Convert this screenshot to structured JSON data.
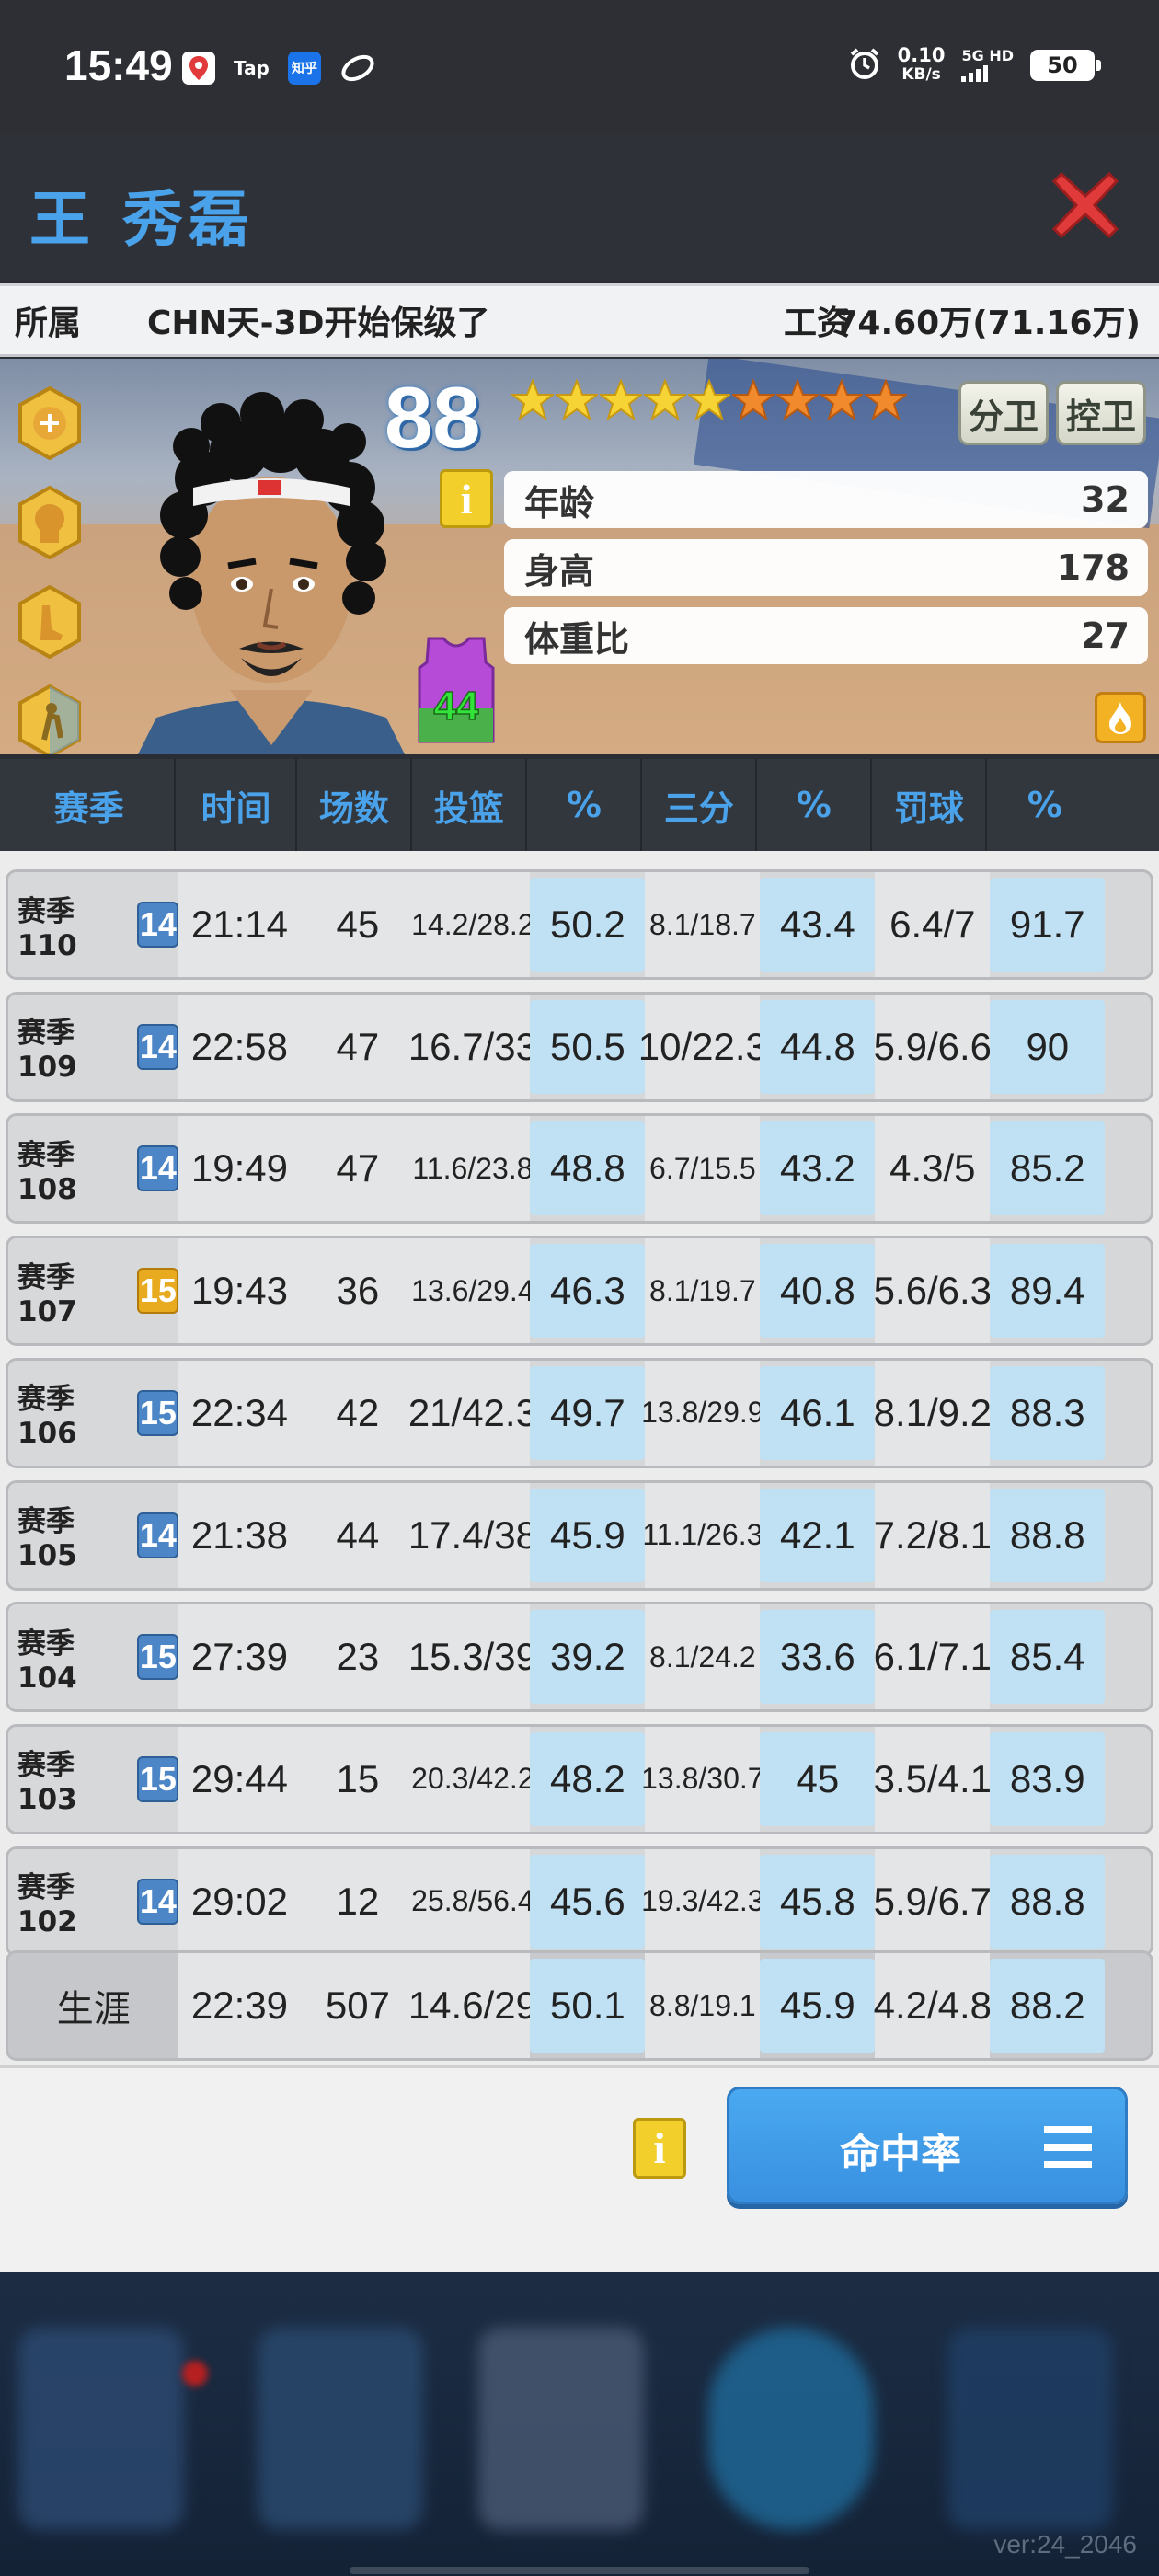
{
  "status_bar": {
    "time": "15:49",
    "apps": [
      "Tap",
      "知乎"
    ],
    "net_speed": "0.10",
    "net_unit": "KB/s",
    "signal": "5G HD",
    "battery": "50"
  },
  "header": {
    "player_name": "王 秀磊"
  },
  "affiliation": {
    "label": "所属",
    "team": "CHN天-3D开始保级了",
    "salary_label": "工资",
    "salary": "74.60万(71.16万)"
  },
  "player": {
    "rating": "88",
    "stars_total": 9,
    "stars_gold": 5,
    "stars_orange": 4,
    "positions": [
      "分卫",
      "控卫"
    ],
    "jersey_number": "44",
    "info_icon": "i",
    "attributes": [
      {
        "label": "年龄",
        "value": "32"
      },
      {
        "label": "身高",
        "value": "178"
      },
      {
        "label": "体重比",
        "value": "27"
      }
    ]
  },
  "table": {
    "headers": [
      "赛季",
      "时间",
      "场数",
      "投篮",
      "%",
      "三分",
      "%",
      "罚球",
      "%"
    ],
    "rows": [
      {
        "season": "赛季110",
        "age": "14",
        "age_color": "blue",
        "time": "21:14",
        "games": "45",
        "fg": "14.2/28.2",
        "fg_pct": "50.2",
        "three": "8.1/18.7",
        "three_pct": "43.4",
        "ft": "6.4/7",
        "ft_pct": "91.7"
      },
      {
        "season": "赛季109",
        "age": "14",
        "age_color": "blue",
        "time": "22:58",
        "games": "47",
        "fg": "16.7/33",
        "fg_pct": "50.5",
        "three": "10/22.3",
        "three_pct": "44.8",
        "ft": "5.9/6.6",
        "ft_pct": "90"
      },
      {
        "season": "赛季108",
        "age": "14",
        "age_color": "blue",
        "time": "19:49",
        "games": "47",
        "fg": "11.6/23.8",
        "fg_pct": "48.8",
        "three": "6.7/15.5",
        "three_pct": "43.2",
        "ft": "4.3/5",
        "ft_pct": "85.2"
      },
      {
        "season": "赛季107",
        "age": "15",
        "age_color": "gold",
        "time": "19:43",
        "games": "36",
        "fg": "13.6/29.4",
        "fg_pct": "46.3",
        "three": "8.1/19.7",
        "three_pct": "40.8",
        "ft": "5.6/6.3",
        "ft_pct": "89.4"
      },
      {
        "season": "赛季106",
        "age": "15",
        "age_color": "blue",
        "time": "22:34",
        "games": "42",
        "fg": "21/42.3",
        "fg_pct": "49.7",
        "three": "13.8/29.9",
        "three_pct": "46.1",
        "ft": "8.1/9.2",
        "ft_pct": "88.3"
      },
      {
        "season": "赛季105",
        "age": "14",
        "age_color": "blue",
        "time": "21:38",
        "games": "44",
        "fg": "17.4/38",
        "fg_pct": "45.9",
        "three": "11.1/26.3",
        "three_pct": "42.1",
        "ft": "7.2/8.1",
        "ft_pct": "88.8"
      },
      {
        "season": "赛季104",
        "age": "15",
        "age_color": "blue",
        "time": "27:39",
        "games": "23",
        "fg": "15.3/39",
        "fg_pct": "39.2",
        "three": "8.1/24.2",
        "three_pct": "33.6",
        "ft": "6.1/7.1",
        "ft_pct": "85.4"
      },
      {
        "season": "赛季103",
        "age": "15",
        "age_color": "blue",
        "time": "29:44",
        "games": "15",
        "fg": "20.3/42.2",
        "fg_pct": "48.2",
        "three": "13.8/30.7",
        "three_pct": "45",
        "ft": "3.5/4.1",
        "ft_pct": "83.9"
      },
      {
        "season": "赛季102",
        "age": "14",
        "age_color": "blue",
        "time": "29:02",
        "games": "12",
        "fg": "25.8/56.4",
        "fg_pct": "45.6",
        "three": "19.3/42.3",
        "three_pct": "45.8",
        "ft": "5.9/6.7",
        "ft_pct": "88.8"
      }
    ],
    "career": {
      "season": "生涯",
      "time": "22:39",
      "games": "507",
      "fg": "14.6/29",
      "fg_pct": "50.1",
      "three": "8.8/19.1",
      "three_pct": "45.9",
      "ft": "4.2/4.8",
      "ft_pct": "88.2"
    }
  },
  "footer": {
    "info_icon": "i",
    "sort_button_label": "命中率"
  },
  "nav": {
    "version": "ver:24_2046"
  },
  "colors": {
    "accent_blue": "#4aa3ea",
    "close_red": "#e03a3a",
    "pct_highlight": "#bfe1f3",
    "badge_gold": "#e8aa1f"
  }
}
